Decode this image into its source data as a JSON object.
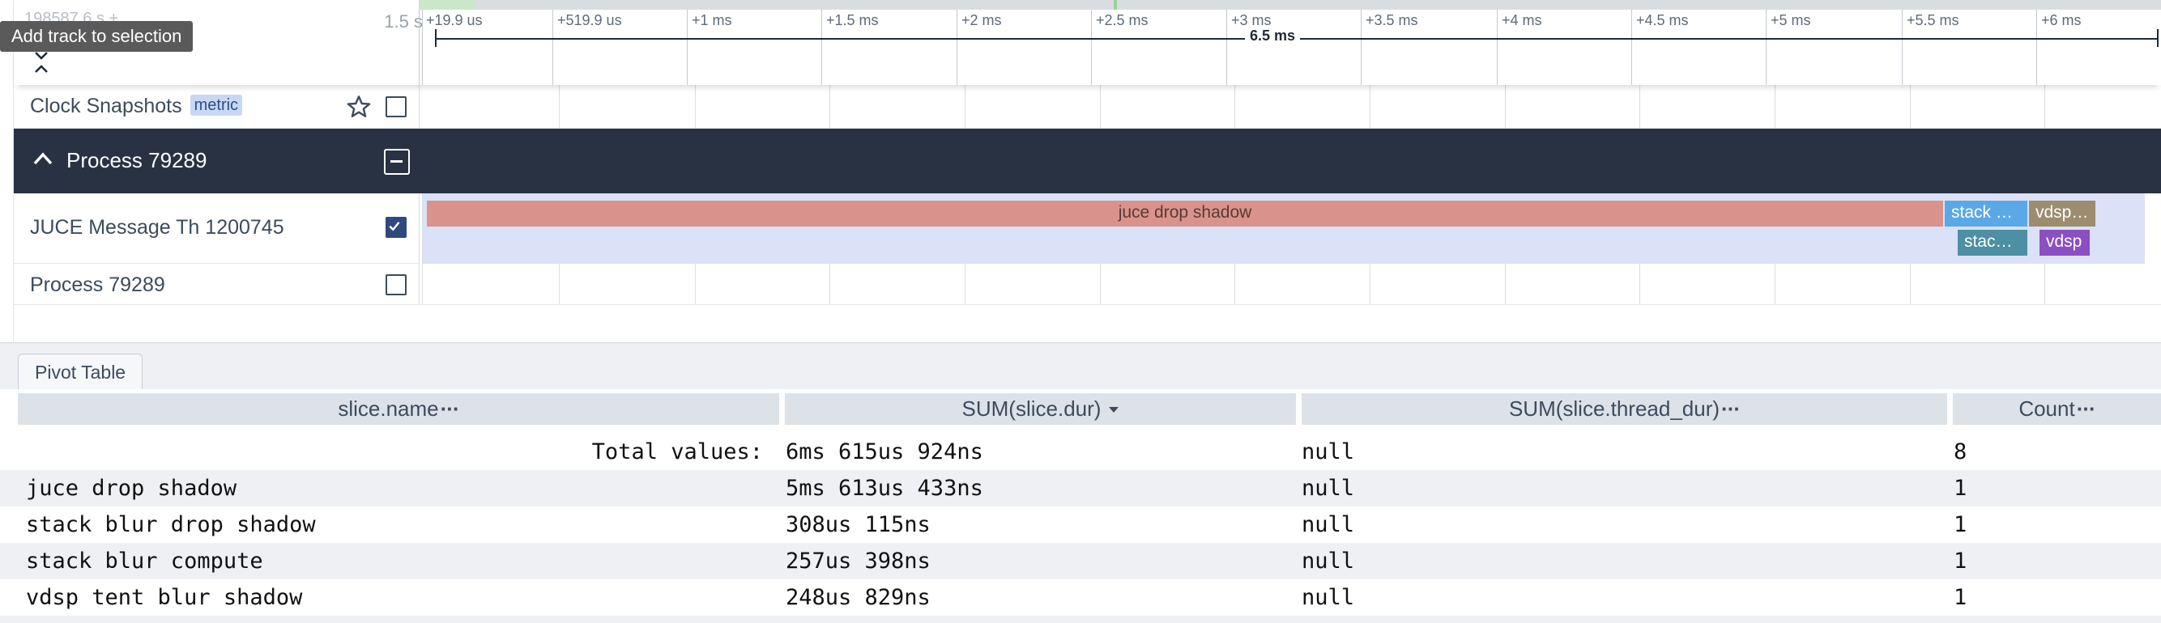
{
  "timeline": {
    "timestamp_partial": "198587.6 s +",
    "scale_label": "1.5 s",
    "ticks": [
      "+19.9 us",
      "+519.9 us",
      "+1 ms",
      "+1.5 ms",
      "+2 ms",
      "+2.5 ms",
      "+3 ms",
      "+3.5 ms",
      "+4 ms",
      "+4.5 ms",
      "+5 ms",
      "+5.5 ms",
      "+6 ms"
    ],
    "selection_span": "6.5 ms",
    "tooltip": "Add track to selection"
  },
  "tracks": {
    "clock_snapshots": {
      "label": "Clock Snapshots",
      "badge": "metric"
    },
    "process_group": {
      "label": "Process 79289"
    },
    "juce_thread": {
      "label": "JUCE Message Th 1200745",
      "checked": true,
      "slices": [
        {
          "name": "juce drop shadow",
          "color": "#d9938c",
          "text_color": "#5a3a36"
        },
        {
          "name": "stack blur drop shadow",
          "color": "#5aa9e6"
        },
        {
          "name": "vdsp tent blur shadow",
          "color": "#9c8d6e"
        },
        {
          "name": "stack blur compute",
          "color": "#4d8fa3"
        },
        {
          "name": "vdsp",
          "color": "#8b4fc2"
        }
      ]
    },
    "process_track": {
      "label": "Process 79289",
      "checked": false
    }
  },
  "colors": {
    "selection_bg": "#dbe1f7",
    "header_dark": "#283242",
    "checked_box": "#2e4a7d"
  },
  "pivot": {
    "tab_label": "Pivot Table",
    "columns": [
      "slice.name",
      "SUM(slice.dur)",
      "SUM(slice.thread_dur)",
      "Count"
    ],
    "sort_column": "SUM(slice.dur)",
    "total_label": "Total values:",
    "total_dur": "6ms 615us 924ns",
    "total_thread_dur": "null",
    "total_count": "8",
    "rows": [
      {
        "name": "juce drop shadow",
        "dur": "5ms 613us 433ns",
        "thread_dur": "null",
        "count": "1"
      },
      {
        "name": "stack blur drop shadow",
        "dur": "308us 115ns",
        "thread_dur": "null",
        "count": "1"
      },
      {
        "name": "stack blur compute",
        "dur": "257us 398ns",
        "thread_dur": "null",
        "count": "1"
      },
      {
        "name": "vdsp tent blur shadow",
        "dur": "248us 829ns",
        "thread_dur": "null",
        "count": "1"
      }
    ]
  }
}
